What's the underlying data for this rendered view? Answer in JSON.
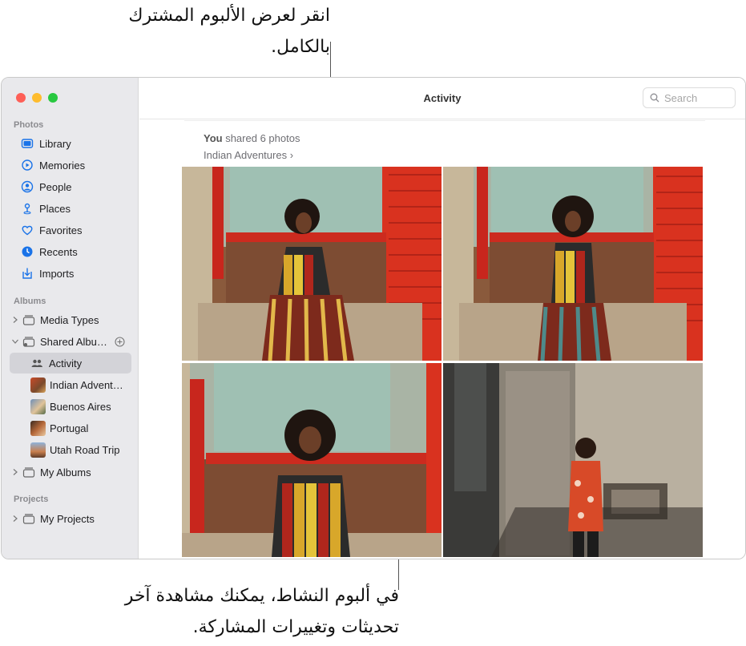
{
  "callouts": {
    "top": "انقر لعرض الألبوم المشترك بالكامل.",
    "bottom": "في ألبوم النشاط، يمكنك مشاهدة آخر تحديثات وتغييرات المشاركة."
  },
  "toolbar": {
    "title": "Activity",
    "search_placeholder": "Search"
  },
  "sidebar": {
    "photos_header": "Photos",
    "photos_items": [
      {
        "label": "Library",
        "icon": "library-icon"
      },
      {
        "label": "Memories",
        "icon": "memories-icon"
      },
      {
        "label": "People",
        "icon": "people-icon"
      },
      {
        "label": "Places",
        "icon": "places-icon"
      },
      {
        "label": "Favorites",
        "icon": "heart-icon"
      },
      {
        "label": "Recents",
        "icon": "clock-icon"
      },
      {
        "label": "Imports",
        "icon": "import-icon"
      }
    ],
    "albums_header": "Albums",
    "media_types": "Media Types",
    "shared_albums": "Shared Albu…",
    "activity": "Activity",
    "shared_items": [
      "Indian Advent…",
      "Buenos Aires",
      "Portugal",
      "Utah Road Trip"
    ],
    "my_albums": "My Albums",
    "projects_header": "Projects",
    "my_projects": "My Projects"
  },
  "activity": {
    "who": "You",
    "action": " shared 6 photos",
    "album_link": "Indian Adventures",
    "chevron": "›"
  },
  "colors": {
    "accent": "#1a73e8",
    "sidebar_bg": "#e9e9ec",
    "selected_bg": "#d3d3d8"
  }
}
